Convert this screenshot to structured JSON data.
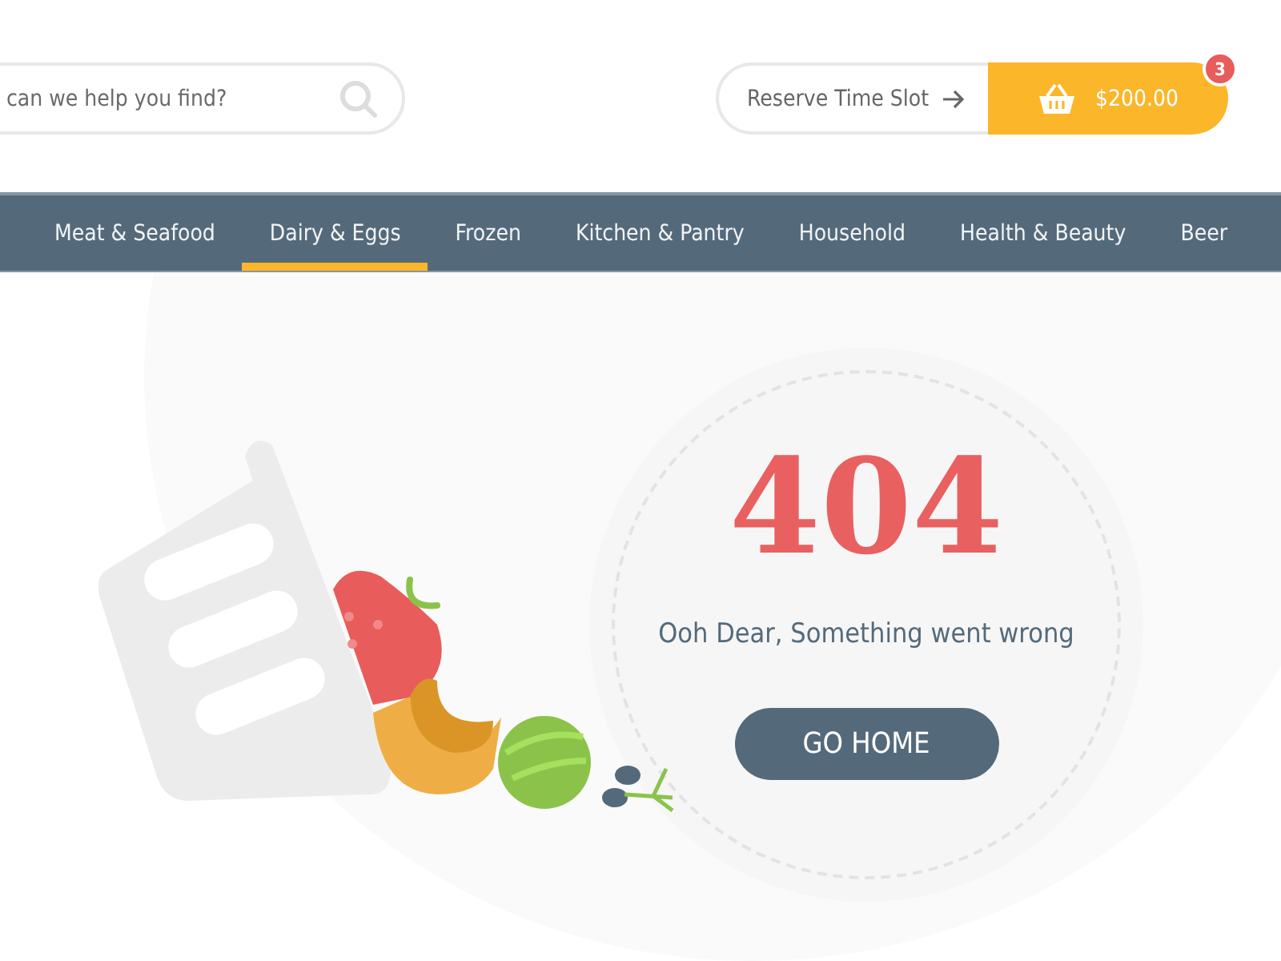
{
  "search": {
    "placeholder": "can we help you find?"
  },
  "reserve": {
    "label": "Reserve Time Slot"
  },
  "cart": {
    "total": "$200.00",
    "count": "3"
  },
  "nav": [
    {
      "label": "Meat & Seafood",
      "selected": false
    },
    {
      "label": "Dairy & Eggs",
      "selected": true
    },
    {
      "label": "Frozen",
      "selected": false
    },
    {
      "label": "Kitchen & Pantry",
      "selected": false
    },
    {
      "label": "Household",
      "selected": false
    },
    {
      "label": "Health & Beauty",
      "selected": false
    },
    {
      "label": "Beer",
      "selected": false
    }
  ],
  "error": {
    "code": "404",
    "message": "Ooh Dear, Something went wrong",
    "button": "GO HOME"
  }
}
